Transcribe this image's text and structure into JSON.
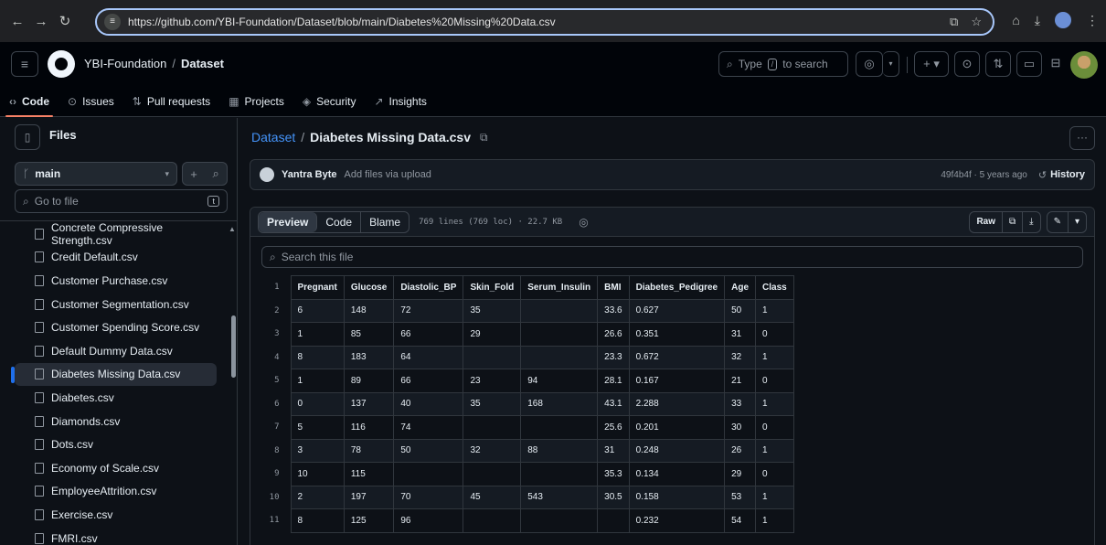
{
  "browser": {
    "url": "https://github.com/YBI-Foundation/Dataset/blob/main/Diabetes%20Missing%20Data.csv"
  },
  "header": {
    "org": "YBI-Foundation",
    "separator": "/",
    "repo": "Dataset",
    "search_placeholder": "Type",
    "search_key": "/",
    "search_suffix": "to search"
  },
  "reponav": {
    "tabs": [
      {
        "label": "Code",
        "icon": "code-icon"
      },
      {
        "label": "Issues",
        "icon": "issues-icon"
      },
      {
        "label": "Pull requests",
        "icon": "pull-request-icon"
      },
      {
        "label": "Projects",
        "icon": "projects-icon"
      },
      {
        "label": "Security",
        "icon": "shield-icon"
      },
      {
        "label": "Insights",
        "icon": "graph-icon"
      }
    ]
  },
  "sidebar": {
    "title": "Files",
    "branch": "main",
    "goto_placeholder": "Go to file",
    "goto_key": "t",
    "files": [
      "Concrete Compressive Strength.csv",
      "Credit Default.csv",
      "Customer Purchase.csv",
      "Customer Segmentation.csv",
      "Customer Spending Score.csv",
      "Default Dummy Data.csv",
      "Diabetes Missing Data.csv",
      "Diabetes.csv",
      "Diamonds.csv",
      "Dots.csv",
      "Economy of Scale.csv",
      "EmployeeAttrition.csv",
      "Exercise.csv",
      "FMRI.csv"
    ]
  },
  "main": {
    "repo_link": "Dataset",
    "path_sep": "/",
    "file_name": "Diabetes Missing Data.csv",
    "commit": {
      "author": "Yantra Byte",
      "message": "Add files via upload",
      "meta": "49f4b4f · 5 years ago",
      "history": "History"
    },
    "view_tabs": {
      "preview": "Preview",
      "code": "Code",
      "blame": "Blame"
    },
    "line_info": "769 lines (769 loc) · 22.7 KB",
    "raw_label": "Raw",
    "search_placeholder": "Search this file",
    "table": {
      "line_numbers": [
        "1",
        "2",
        "3",
        "4",
        "5",
        "6",
        "7",
        "8",
        "9",
        "10",
        "11"
      ],
      "header": [
        "Pregnant",
        "Glucose",
        "Diastolic_BP",
        "Skin_Fold",
        "Serum_Insulin",
        "BMI",
        "Diabetes_Pedigree",
        "Age",
        "Class"
      ],
      "rows": [
        [
          "6",
          "148",
          "72",
          "35",
          "",
          "33.6",
          "0.627",
          "50",
          "1"
        ],
        [
          "1",
          "85",
          "66",
          "29",
          "",
          "26.6",
          "0.351",
          "31",
          "0"
        ],
        [
          "8",
          "183",
          "64",
          "",
          "",
          "23.3",
          "0.672",
          "32",
          "1"
        ],
        [
          "1",
          "89",
          "66",
          "23",
          "94",
          "28.1",
          "0.167",
          "21",
          "0"
        ],
        [
          "0",
          "137",
          "40",
          "35",
          "168",
          "43.1",
          "2.288",
          "33",
          "1"
        ],
        [
          "5",
          "116",
          "74",
          "",
          "",
          "25.6",
          "0.201",
          "30",
          "0"
        ],
        [
          "3",
          "78",
          "50",
          "32",
          "88",
          "31",
          "0.248",
          "26",
          "1"
        ],
        [
          "10",
          "115",
          "",
          "",
          "",
          "35.3",
          "0.134",
          "29",
          "0"
        ],
        [
          "2",
          "197",
          "70",
          "45",
          "543",
          "30.5",
          "0.158",
          "53",
          "1"
        ],
        [
          "8",
          "125",
          "96",
          "",
          "",
          "",
          "0.232",
          "54",
          "1"
        ]
      ]
    }
  },
  "colors": {
    "accent_link": "#4493f8",
    "active_tab_underline": "#f78166",
    "active_file_marker": "#1f6feb"
  }
}
